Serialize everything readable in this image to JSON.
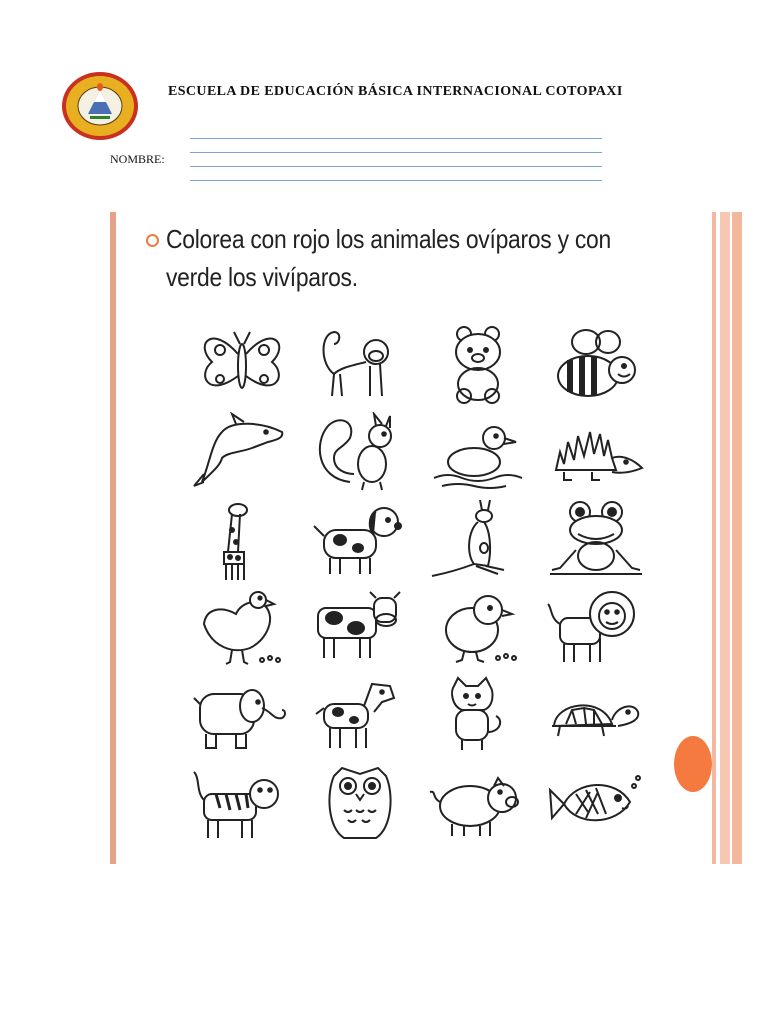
{
  "header": {
    "school_name": "ESCUELA DE EDUCACIÓN BÁSICA INTERNACIONAL COTOPAXI",
    "name_label": "NOMBRE:"
  },
  "slide": {
    "instruction": "Colorea con rojo los animales ovíparos y con verde los vivíparos.",
    "animals": [
      {
        "name": "butterfly-icon"
      },
      {
        "name": "monkey-icon"
      },
      {
        "name": "bear-icon"
      },
      {
        "name": "bee-icon"
      },
      {
        "name": "dolphin-icon"
      },
      {
        "name": "squirrel-icon"
      },
      {
        "name": "duck-icon"
      },
      {
        "name": "hedgehog-icon"
      },
      {
        "name": "giraffe-icon"
      },
      {
        "name": "dog-icon"
      },
      {
        "name": "kangaroo-icon"
      },
      {
        "name": "frog-icon"
      },
      {
        "name": "hen-icon"
      },
      {
        "name": "cow-icon"
      },
      {
        "name": "chick-icon"
      },
      {
        "name": "lion-icon"
      },
      {
        "name": "elephant-icon"
      },
      {
        "name": "horse-icon"
      },
      {
        "name": "cat-icon"
      },
      {
        "name": "turtle-icon"
      },
      {
        "name": "tiger-icon"
      },
      {
        "name": "owl-icon"
      },
      {
        "name": "pig-icon"
      },
      {
        "name": "fish-icon"
      }
    ]
  },
  "colors": {
    "accent_orange": "#f47a40",
    "border_salmon": "#e7a389",
    "line_blue": "#7fa2d6"
  }
}
